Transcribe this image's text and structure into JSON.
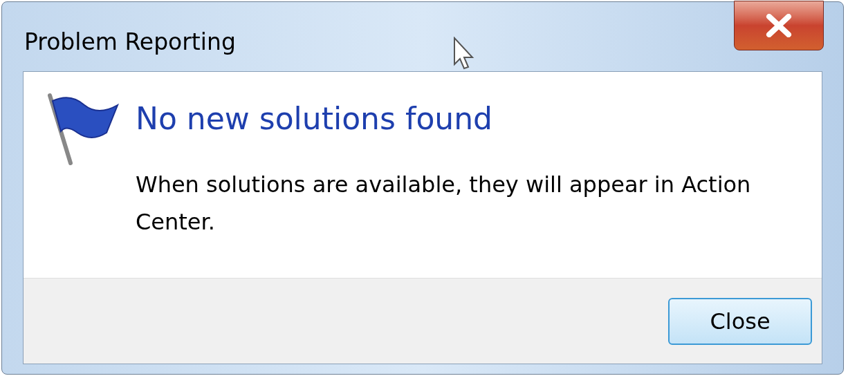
{
  "window": {
    "title": "Problem Reporting"
  },
  "heading": "No new solutions found",
  "message": "When solutions are available, they will appear in Action Center.",
  "buttons": [
    {
      "label": "Close",
      "selected": true
    }
  ]
}
